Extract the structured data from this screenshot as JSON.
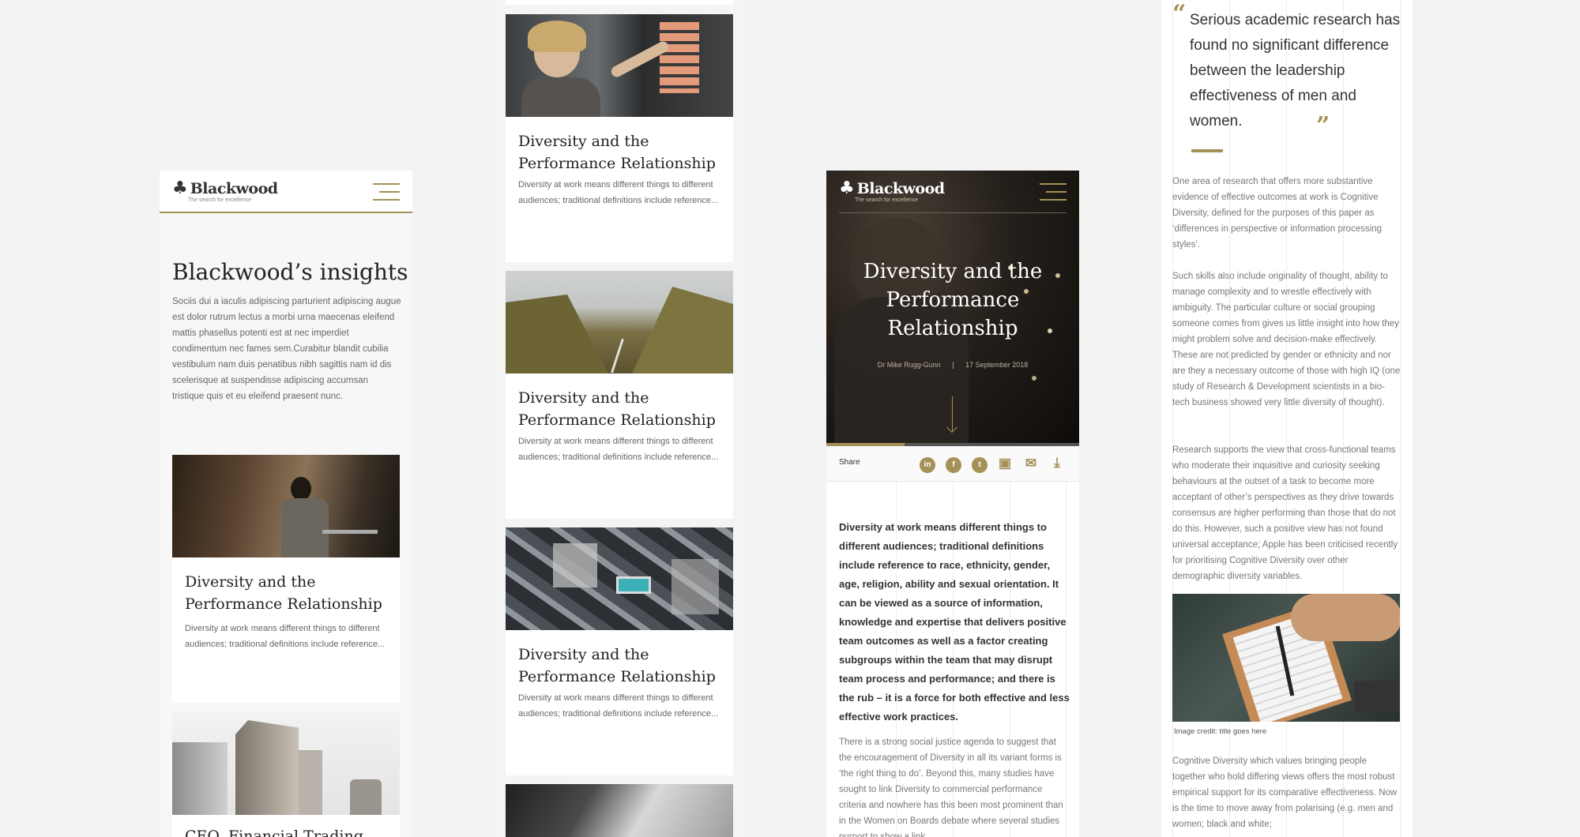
{
  "brand": {
    "name": "Blackwood",
    "tagline": "The search for excellence"
  },
  "colors": {
    "accent": "#a39157",
    "text": "#222222",
    "muted": "#666666",
    "background": "#f3f3f3"
  },
  "listing": {
    "title": "Blackwood’s insights",
    "intro": "Sociis dui a iaculis adipiscing parturient adipiscing augue est dolor rutrum lectus a morbi urna maecenas eleifend mattis phasellus potenti est at nec imperdiet condimentum nec fames sem.Curabitur blandit cubilia vestibulum nam duis penatibus nibh sagittis nam id dis scelerisque at suspendisse adipiscing accumsan tristique quis et eu eleifend praesent nunc.",
    "cards": [
      {
        "title": "Diversity and the Performance Relationship",
        "excerpt": "Diversity at work means different things to different audiences; traditional definitions include reference..."
      },
      {
        "title": "CEO, Financial Trading",
        "excerpt": ""
      }
    ]
  },
  "cards_column": [
    {
      "title": "Diversity and the Performance Relationship",
      "excerpt": "Diversity at work means different things to different audiences; traditional definitions include reference..."
    },
    {
      "title": "Diversity and the Performance Relationship",
      "excerpt": "Diversity at work means different things to different audiences; traditional definitions include reference..."
    },
    {
      "title": "Diversity and the Performance Relationship",
      "excerpt": "Diversity at work means different things to different audiences; traditional definitions include reference..."
    }
  ],
  "article": {
    "title": "Diversity and the Performance Relationship",
    "author": "Dr Mike Rugg-Gunn",
    "date": "17 September 2018",
    "share_label": "Share",
    "share_icons": [
      "linkedin-icon",
      "facebook-icon",
      "twitter-icon",
      "print-icon",
      "email-icon",
      "download-icon"
    ],
    "lead": "Diversity at work means different things to different audiences; traditional definitions include reference to race, ethnicity, gender, age, religion, ability and sexual orientation. It can be viewed as a source of information, knowledge and expertise that delivers positive team outcomes as well as a factor creating subgroups within the team that may disrupt team process and performance; and there is the rub – it is a force for both effective and less effective work practices.",
    "body": "There is a strong social justice agenda to suggest that the encouragement of Diversity in all its variant forms is ‘the right thing to do’. Beyond this, many studies have sought to link Diversity to commercial performance criteria and nowhere has this been most prominent than in the Women on Boards debate where several studies purport to show a link"
  },
  "article_cont": {
    "quote": "Serious academic research has found no significant difference between the leadership effectiveness of men and women.",
    "p1": "One area of research that offers more substantive evidence of effective outcomes at work is Cognitive Diversity, defined for the purposes of this paper as ‘differences in perspective or information processing styles’.",
    "p2": "Such skills also include originality of thought, ability to manage complexity and to wrestle effectively with ambiguity. The particular culture or social grouping someone comes from gives us little insight into how they might problem solve and decision-make effectively. These are not predicted by gender or ethnicity and nor are they a necessary outcome of those with high IQ (one study of Research & Development scientists in a bio-tech business showed very little diversity of thought).",
    "p3": "Research supports the view that cross-functional teams who moderate their inquisitive and curiosity seeking behaviours at the outset of a task to become more acceptant of other’s perspectives as they drive towards consensus are higher performing than those that do not do this. However, such a positive view has not found universal acceptance; Apple has been criticised recently for prioritising Cognitive Diversity over other demographic diversity variables.",
    "image_credit": "Image credit: title goes here",
    "p4": "Cognitive Diversity which values bringing people together who hold differing views offers the most robust empirical support for its comparative effectiveness. Now is the time to move away from polarising (e.g. men and women; black and white;"
  }
}
